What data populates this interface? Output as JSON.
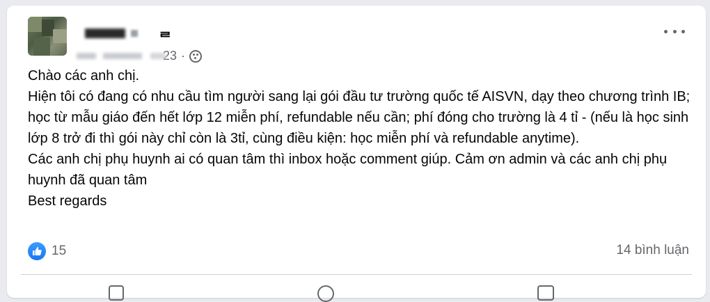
{
  "post": {
    "author_name_visible_suffix": "ᄅ",
    "date": "23",
    "separator": "·",
    "privacy_icon": "globe-icon",
    "more_icon": "more-horizontal-icon",
    "paragraphs": [
      "Chào các anh chị.",
      "Hiện tôi có đang có nhu cầu tìm người sang lại gói đầu tư trường quốc tế AISVN, dạy theo chương trình IB; học từ mẫu giáo đến hết lớp 12 miễn phí, refundable nếu cần; phí đóng cho trường là 4 tỉ - (nếu là học sinh lớp 8 trở đi thì gói này chỉ còn là 3tỉ, cùng điều kiện: học miễn phí và refundable anytime).",
      "Các anh chị phụ huynh ai có quan tâm thì inbox hoặc comment giúp. Cảm ơn admin và các anh chị phụ huynh đã quan tâm",
      "Best regards"
    ],
    "reaction_icon": "like-icon",
    "reaction_count": "15",
    "comments_label": "14 bình luận"
  },
  "colors": {
    "background": "#e9ebee",
    "card": "#ffffff",
    "text": "#050505",
    "secondary_text": "#65676b",
    "like_blue": "#1877f2"
  }
}
